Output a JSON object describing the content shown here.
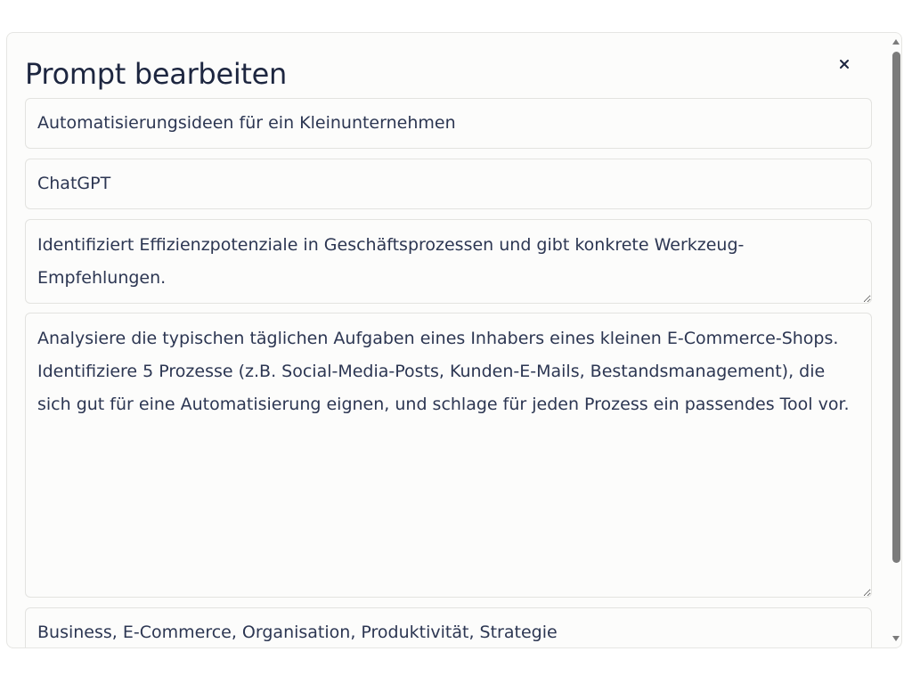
{
  "dialog": {
    "title": "Prompt bearbeiten",
    "close_label": "×"
  },
  "form": {
    "title_value": "Automatisierungsideen für ein Kleinunternehmen",
    "model_value": "ChatGPT",
    "description_value": "Identifiziert Effizienzpotenziale in Geschäftsprozessen und gibt konkrete Werkzeug-Empfehlungen.",
    "prompt_value": "Analysiere die typischen täglichen Aufgaben eines Inhabers eines kleinen E-Commerce-Shops. Identifiziere 5 Prozesse (z.B. Social-Media-Posts, Kunden-E-Mails, Bestandsmanagement), die sich gut für eine Automatisierung eignen, und schlage für jeden Prozess ein passendes Tool vor.",
    "tags_value": "Business, E-Commerce, Organisation, Produktivität, Strategie"
  },
  "icons": {
    "close": "close-icon",
    "scroll_up": "arrow-up-icon",
    "scroll_down": "arrow-down-icon"
  },
  "colors": {
    "title_text": "#1d2640",
    "field_text": "#2c3652",
    "field_border": "#e3e3e0",
    "scroll_thumb": "#7b7b7b"
  }
}
